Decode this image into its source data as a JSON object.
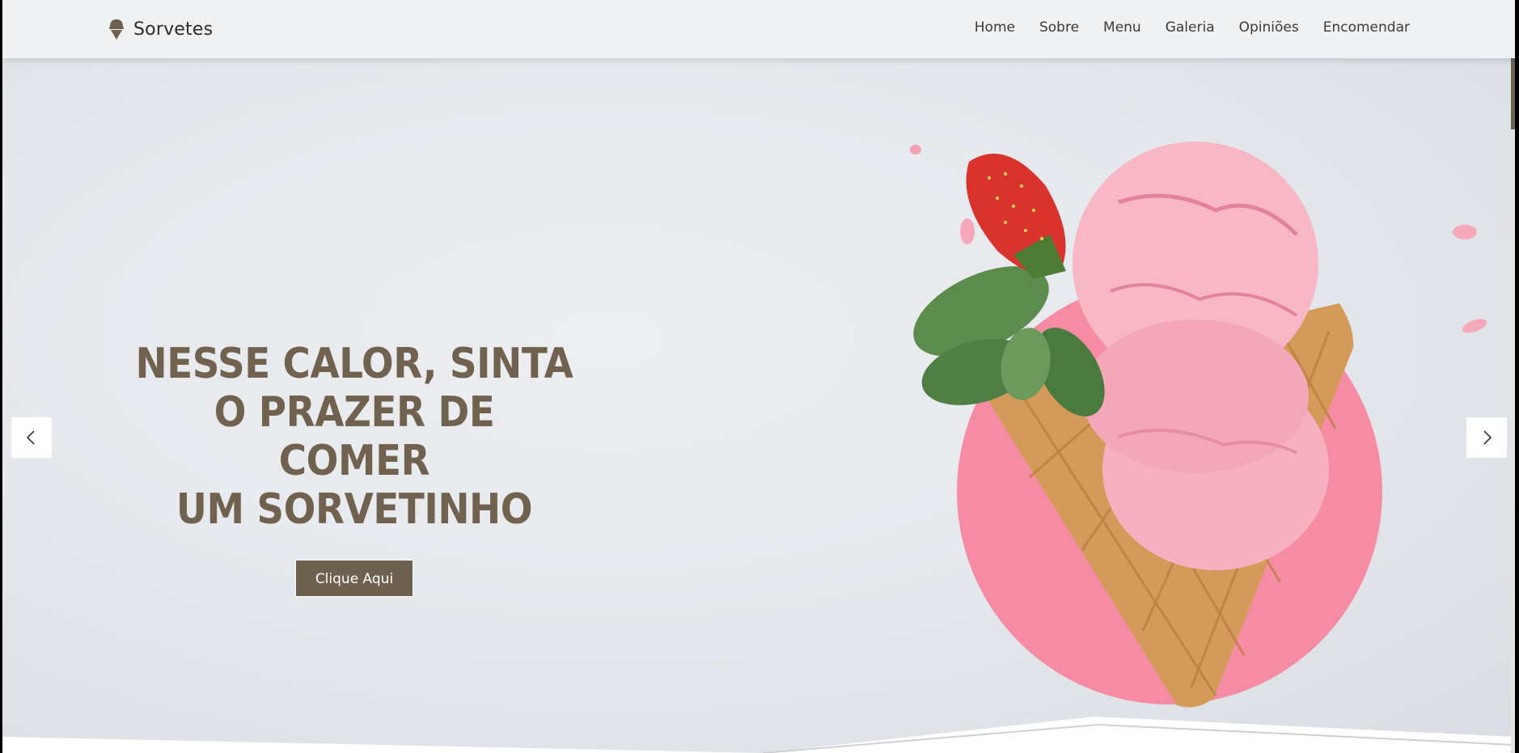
{
  "brand": {
    "name": "Sorvetes",
    "icon": "ice-cream-icon"
  },
  "nav": {
    "items": [
      "Home",
      "Sobre",
      "Menu",
      "Galeria",
      "Opiniões",
      "Encomendar"
    ]
  },
  "hero": {
    "title": "NESSE CALOR, SINTA\nO PRAZER DE COMER\nUM SORVETINHO",
    "cta_label": "Clique Aqui"
  },
  "carousel": {
    "prev_icon": "chevron-left-icon",
    "next_icon": "chevron-right-icon"
  },
  "colors": {
    "accent": "#6e604f",
    "title": "#71624f",
    "pink_circle": "#f68ca4",
    "ice_cream": "#f7b7c4",
    "cone": "#d39a5a"
  }
}
